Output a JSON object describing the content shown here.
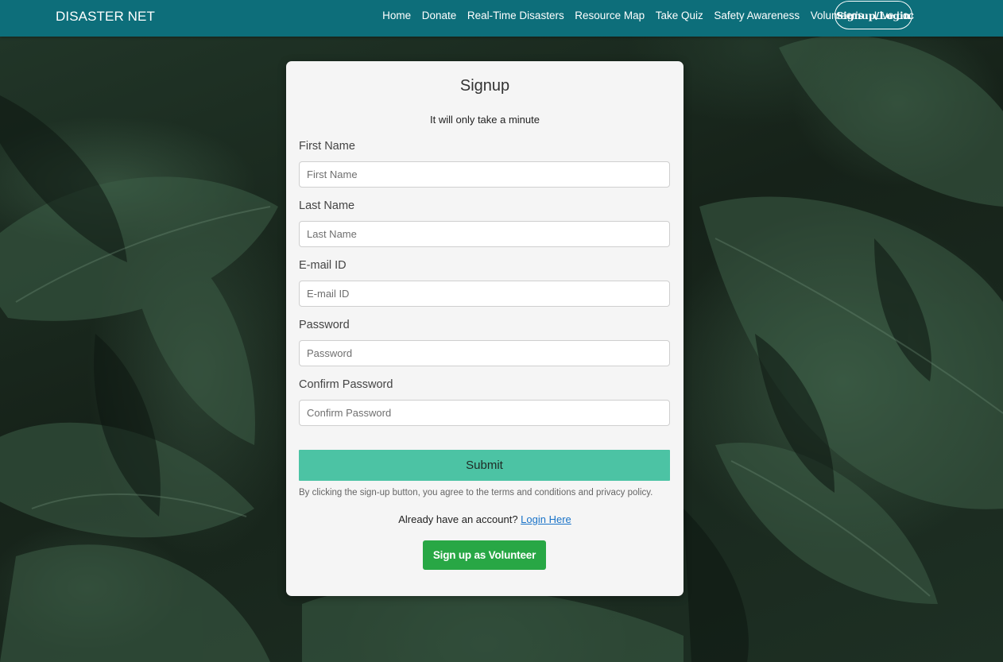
{
  "colors": {
    "navbar_bg": "#0d6e7a",
    "submit_bg": "#4cc3a4",
    "volunteer_bg": "#28a745",
    "link": "#1a73c8",
    "card_bg": "#f5f5f5"
  },
  "navbar": {
    "brand": "DISASTER NET",
    "links": [
      {
        "label": "Home"
      },
      {
        "label": "Donate"
      },
      {
        "label": "Real-Time Disasters"
      },
      {
        "label": "Resource Map"
      },
      {
        "label": "Take Quiz"
      },
      {
        "label": "Safety Awareness"
      },
      {
        "label": "Volunteer's"
      },
      {
        "label": "Live Loc"
      }
    ],
    "signup_login": "Signup/Login"
  },
  "form": {
    "title": "Signup",
    "subtitle": "It will only take a minute",
    "fields": [
      {
        "label": "First Name",
        "placeholder": "First Name",
        "value": ""
      },
      {
        "label": "Last Name",
        "placeholder": "Last Name",
        "value": ""
      },
      {
        "label": "E-mail ID",
        "placeholder": "E-mail ID",
        "value": ""
      },
      {
        "label": "Password",
        "placeholder": "Password",
        "value": ""
      },
      {
        "label": "Confirm Password",
        "placeholder": "Confirm Password",
        "value": ""
      }
    ],
    "submit_label": "Submit",
    "terms_text": "By clicking the sign-up button, you agree to the terms and conditions and privacy policy.",
    "login_prompt": "Already have an account?",
    "login_link": "Login Here",
    "volunteer_button": "Sign up as Volunteer"
  }
}
